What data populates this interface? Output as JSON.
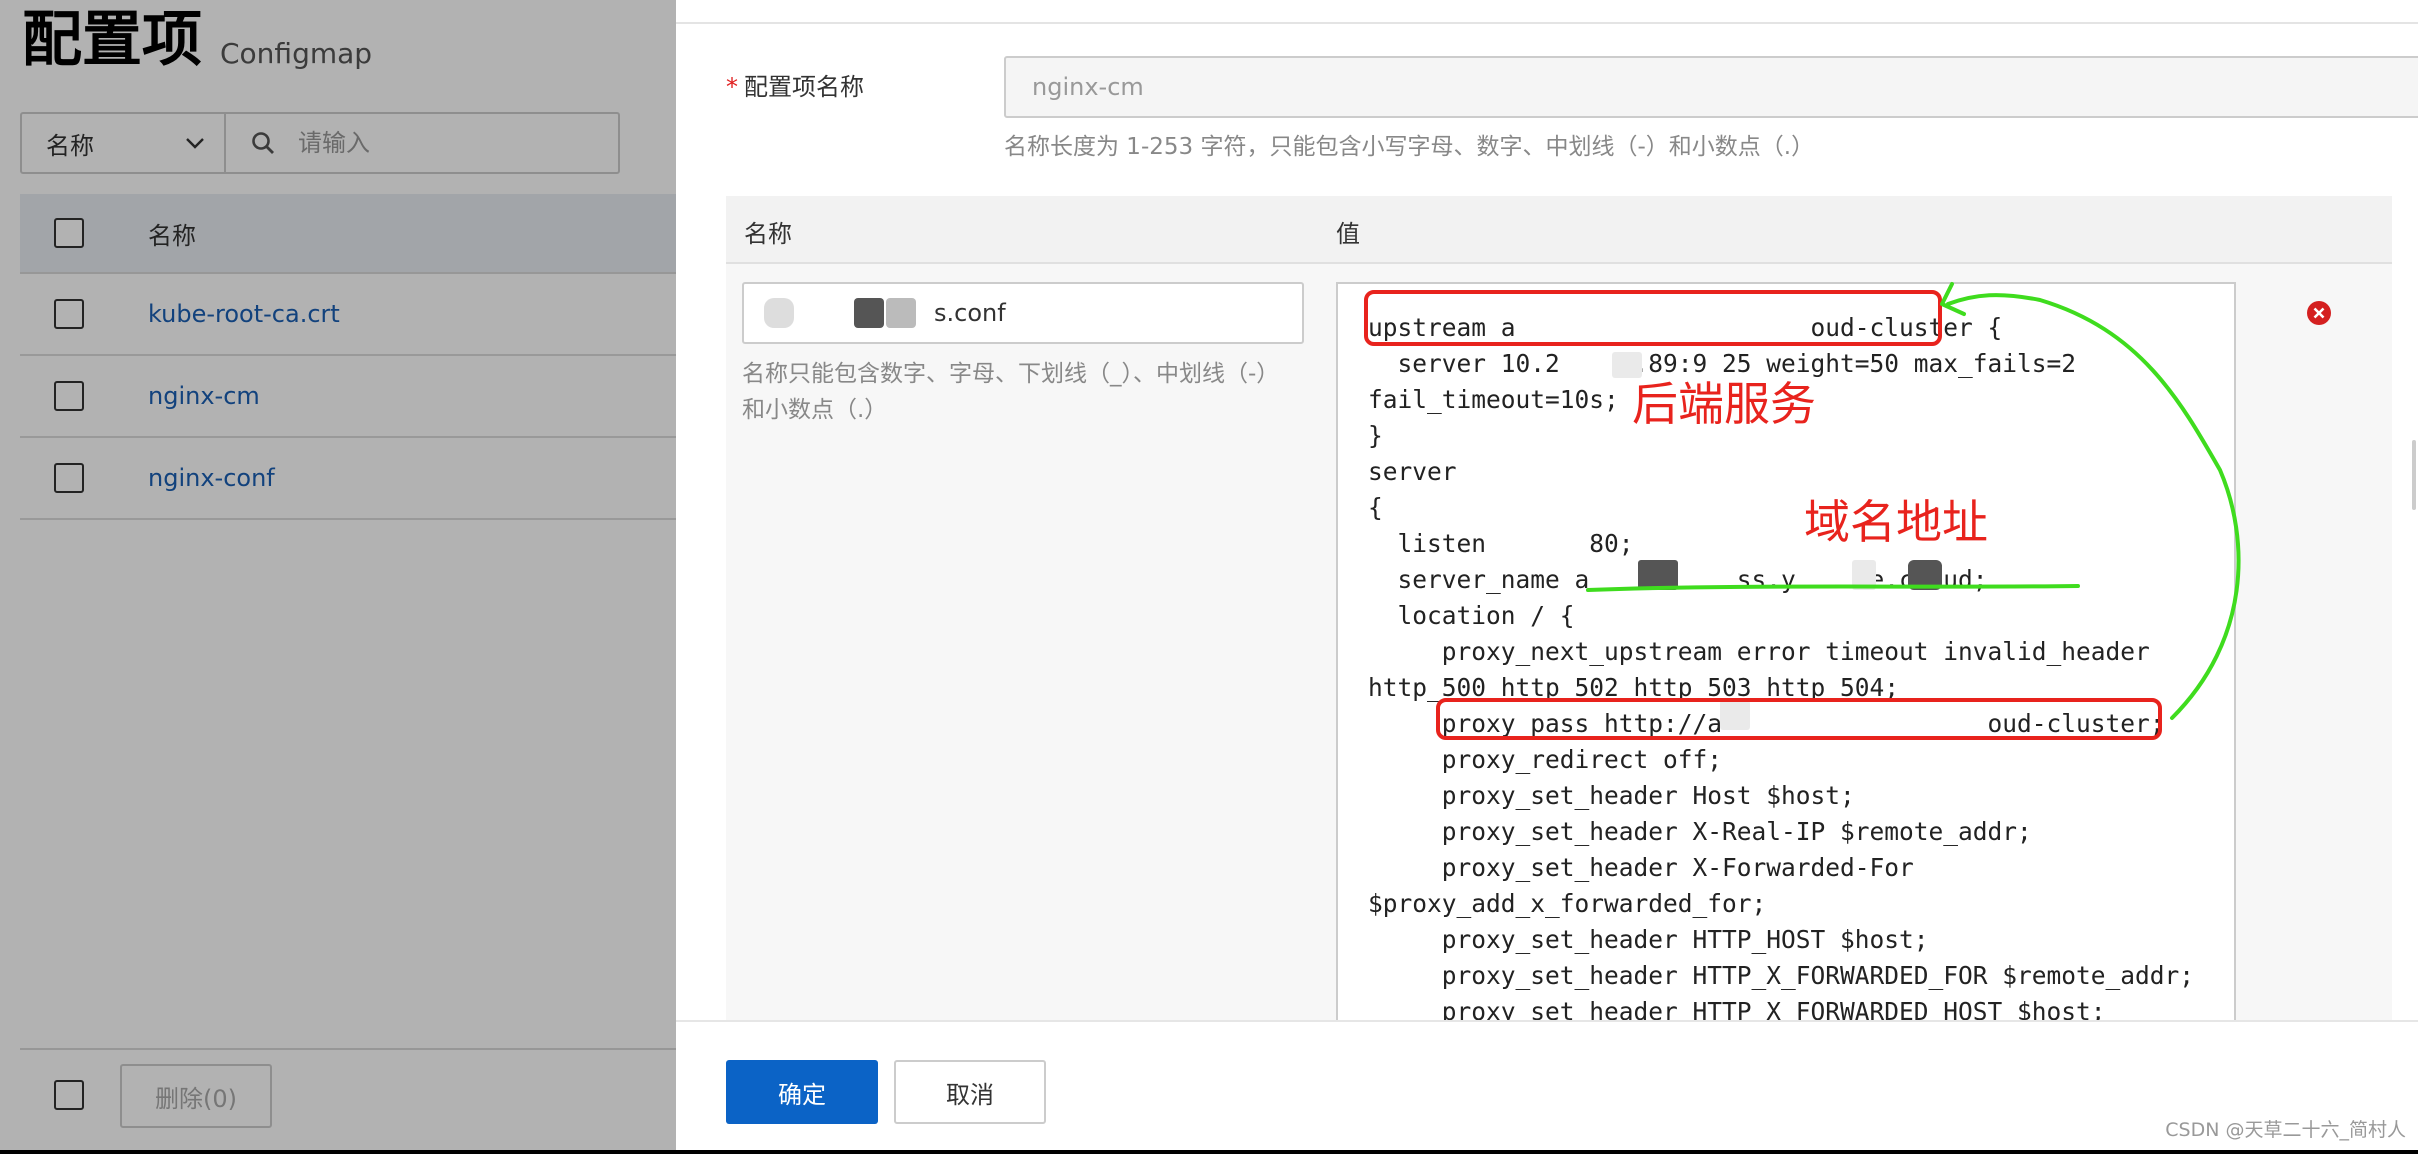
{
  "header": {
    "title": "配置项",
    "subtitle": "Configmap"
  },
  "filter": {
    "field": "名称",
    "search_placeholder": "请输入"
  },
  "table": {
    "column_name": "名称",
    "rows": [
      {
        "name": "kube-root-ca.crt"
      },
      {
        "name": "nginx-cm"
      },
      {
        "name": "nginx-conf"
      }
    ]
  },
  "footer": {
    "delete_label": "删除(0)"
  },
  "drawer": {
    "name_label": "配置项名称",
    "required_mark": "*",
    "name_value": "nginx-cm",
    "name_hint": "名称长度为 1-253 字符，只能包含小写字母、数字、中划线（-）和小数点（.）",
    "kv": {
      "head_name": "名称",
      "head_value": "值",
      "key_value": "s.conf",
      "key_hint": "名称只能包含数字、字母、下划线（_）、中划线（-）和小数点（.）",
      "value_text": "upstream a                    oud-cluster {\n  server 10.2     .89:9 25 weight=50 max_fails=2\nfail_timeout=10s;\n}\nserver\n{\n  listen       80;\n  server_name a          ss.y     e.cloud;\n  location / {\n     proxy_next_upstream error timeout invalid_header\nhttp_500 http_502 http_503 http_504;\n     proxy_pass http://a                  oud-cluster;\n     proxy_redirect off;\n     proxy_set_header Host $host;\n     proxy_set_header X-Real-IP $remote_addr;\n     proxy_set_header X-Forwarded-For\n$proxy_add_x_forwarded_for;\n     proxy_set_header HTTP_HOST $host;\n     proxy_set_header HTTP_X_FORWARDED_FOR $remote_addr;\n     proxy_set_header HTTP_X_FORWARDED_HOST $host;"
    },
    "ok_label": "确定",
    "cancel_label": "取消"
  },
  "annotations": {
    "backend": "后端服务",
    "domain": "域名地址",
    "red_color": "#e8231d",
    "green_color": "#3fdc1e"
  },
  "watermark": "CSDN @天草二十六_简村人"
}
